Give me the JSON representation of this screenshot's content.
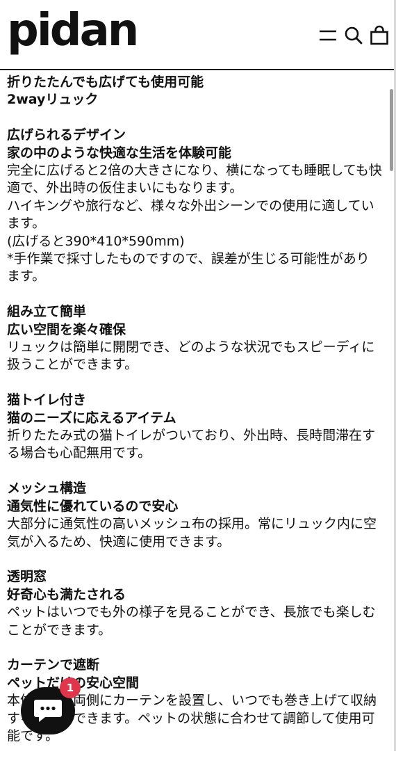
{
  "header": {
    "logo": "pidan",
    "icons": [
      "menu-icon",
      "search-icon",
      "cart-icon"
    ]
  },
  "sections": [
    {
      "headings": [
        "折りたたんでも広げても使用可能",
        "2wayリュック"
      ],
      "paragraphs": []
    },
    {
      "headings": [
        "広げられるデザイン",
        "家の中のような快適な生活を体験可能"
      ],
      "paragraphs": [
        "完全に広げると2倍の大きさになり、横になっても睡眠しても快適で、外出時の仮住まいにもなります。",
        "ハイキングや旅行など、様々な外出シーンでの使用に適しています。",
        "(広げると390*410*590mm)",
        "*手作業で採寸したものですので、誤差が生じる可能性があります。"
      ]
    },
    {
      "headings": [
        "組み立て簡単",
        "広い空間を楽々確保"
      ],
      "paragraphs": [
        "リュックは簡単に開閉でき、どのような状況でもスピーディに扱うことができます。"
      ]
    },
    {
      "headings": [
        "猫トイレ付き",
        "猫のニーズに応えるアイテム"
      ],
      "paragraphs": [
        "折りたたみ式の猫トイレがついており、外出時、長時間滞在する場合も心配無用です。"
      ]
    },
    {
      "headings": [
        "メッシュ構造",
        "通気性に優れているので安心"
      ],
      "paragraphs": [
        "大部分に通気性の高いメッシュ布の採用。常にリュック内に空気が入るため、快適に使用できます。"
      ]
    },
    {
      "headings": [
        "透明窓",
        "好奇心も満たされる"
      ],
      "paragraphs": [
        "ペットはいつでも外の様子を見ることができ、長旅でも楽しむことができます。"
      ]
    },
    {
      "headings": [
        "カーテンで遮断",
        "ペットだけの安心空間"
      ],
      "paragraphs": [
        "本体の前と両側にカーテンを設置し、いつでも巻き上げて収納することができます。ペットの状態に合わせて調節して使用可能です。"
      ]
    }
  ],
  "chat": {
    "icon": "chat-bubble-icon",
    "badge_count": "1",
    "colors": {
      "button": "#111111",
      "badge": "#e0364c"
    }
  },
  "colors": {
    "text": "#111111",
    "background": "#ffffff"
  }
}
